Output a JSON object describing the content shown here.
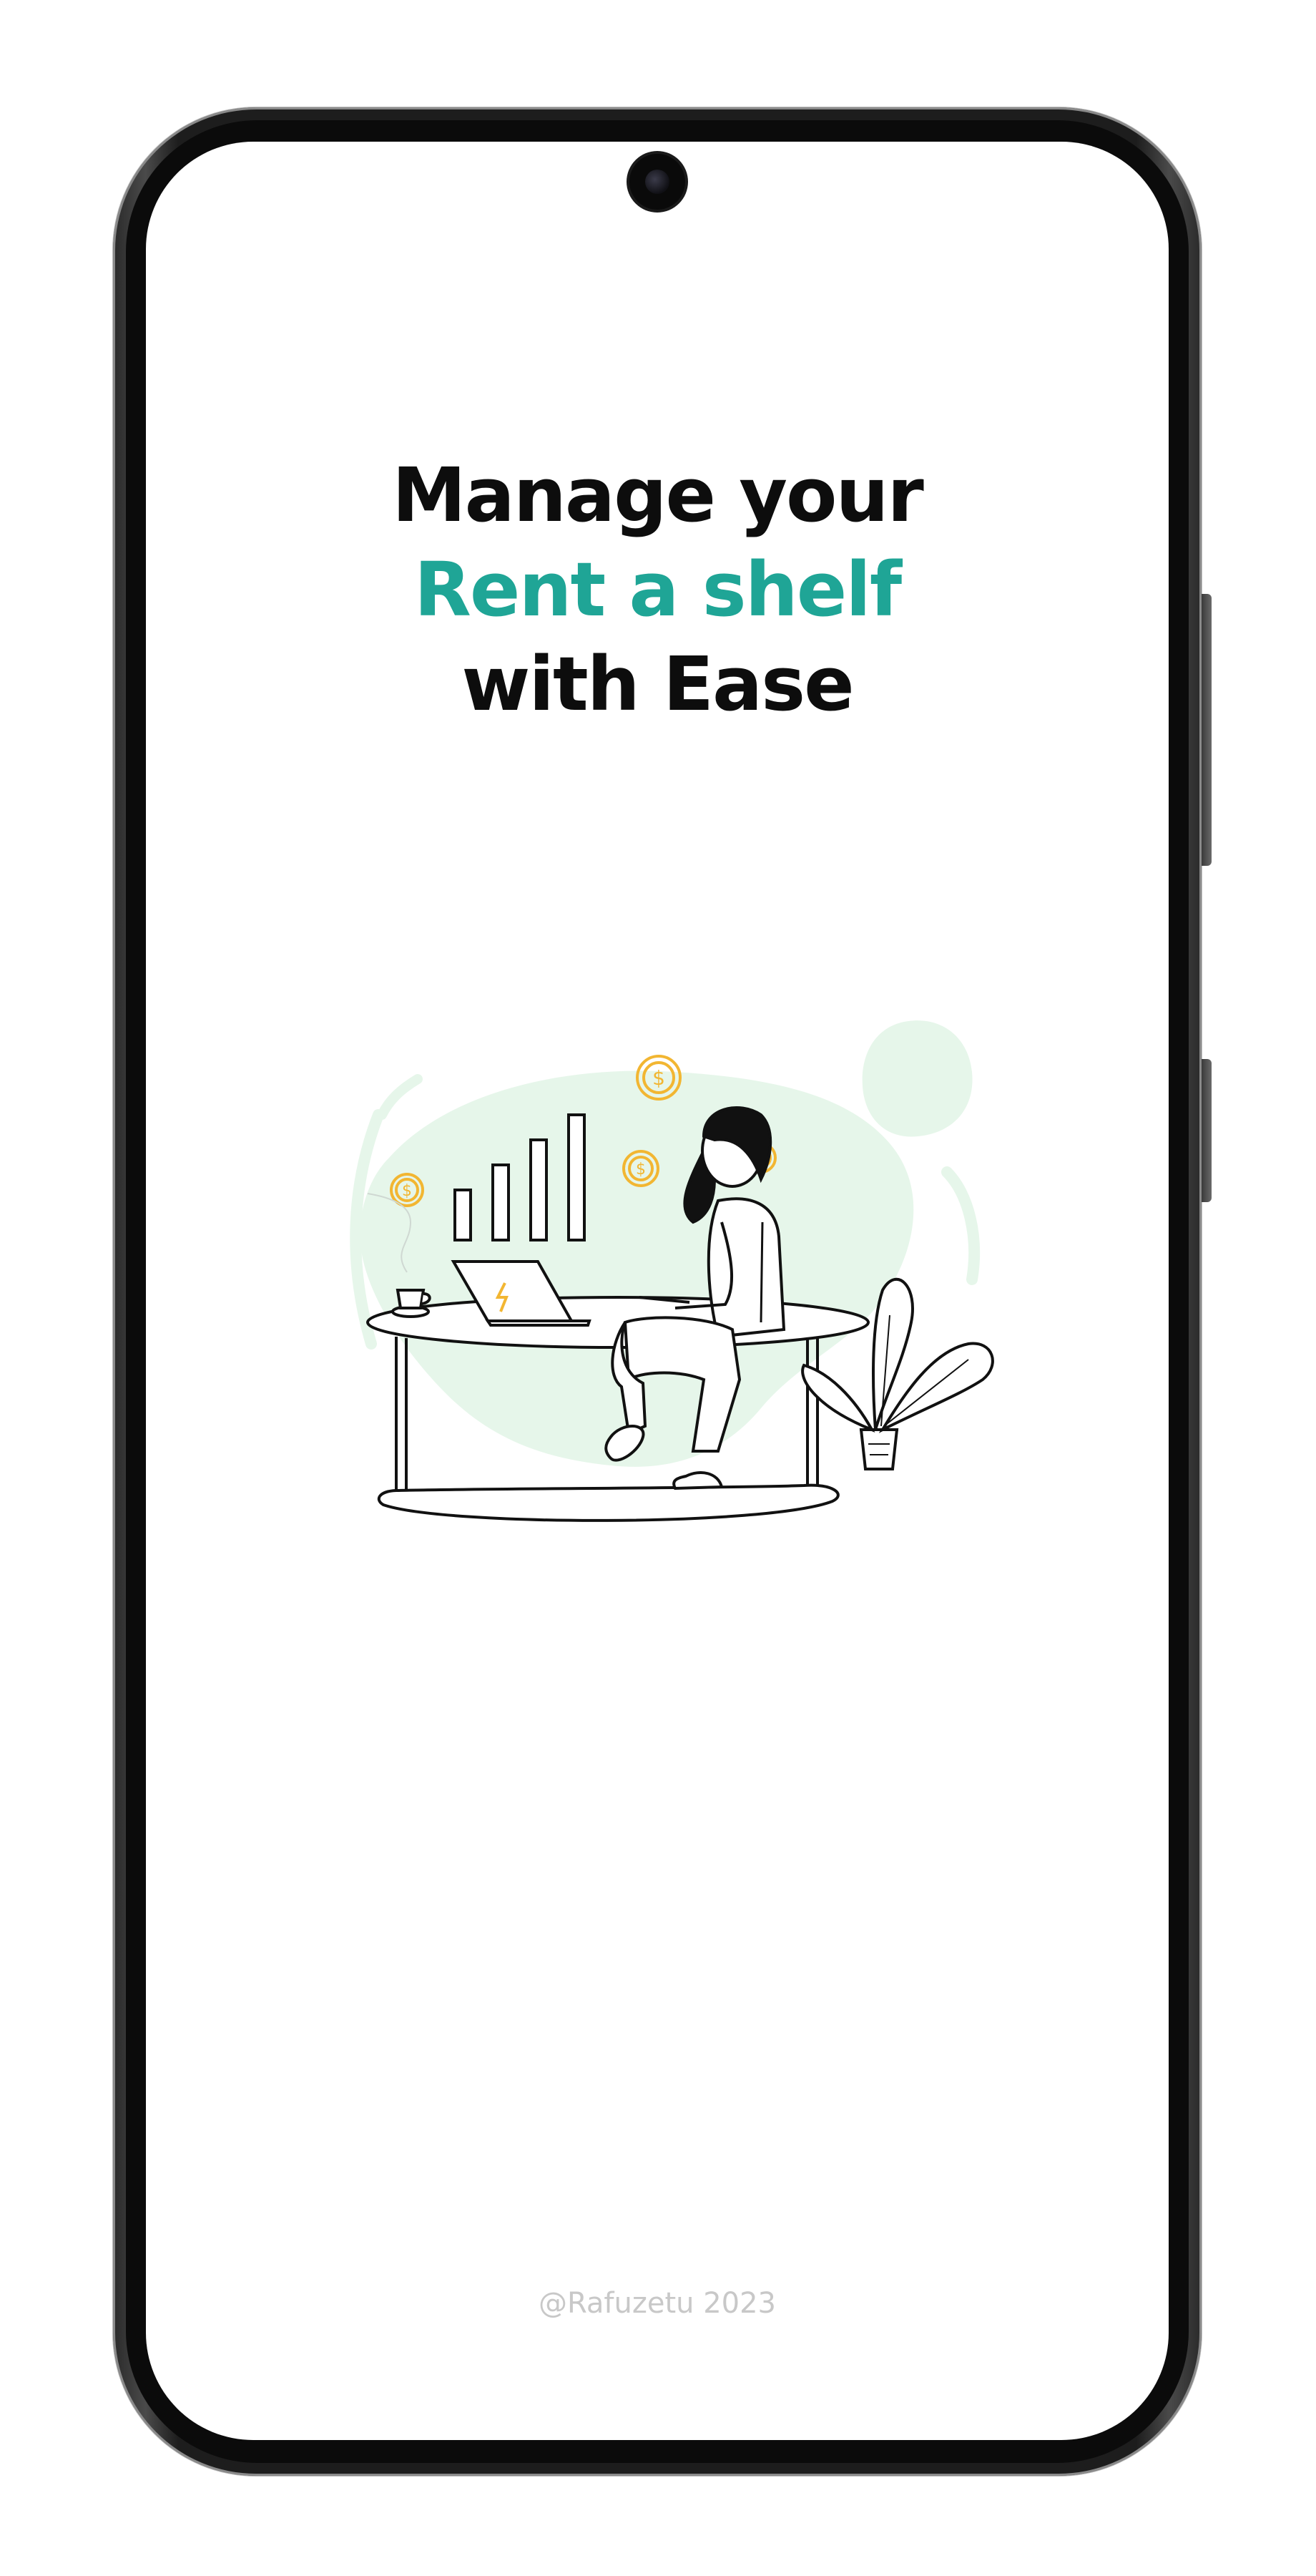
{
  "headline": {
    "line1": "Manage your",
    "line2": "Rent a shelf",
    "line3": "with Ease"
  },
  "footer": {
    "credit": "@Rafuzetu 2023"
  },
  "colors": {
    "accent": "#1fa596",
    "text_dark": "#0d0d0d",
    "blob": "#e6f6ea",
    "coin": "#f2b632",
    "footer_text": "#c8c8c8"
  },
  "illustration": {
    "icon": "person-at-desk-illustration"
  }
}
